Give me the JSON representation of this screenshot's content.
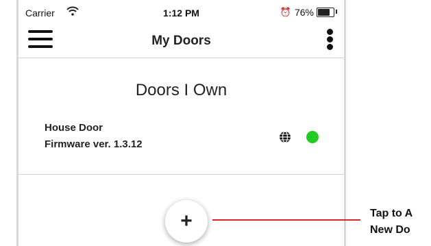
{
  "statusbar": {
    "carrier": "Carrier",
    "time": "1:12 PM",
    "battery_pct": "76%",
    "battery_level": 0.76
  },
  "navbar": {
    "title": "My Doors"
  },
  "section": {
    "title": "Doors I Own"
  },
  "door": {
    "name": "House Door",
    "firmware": "Firmware ver. 1.3.12",
    "status_color": "#22cc22"
  },
  "fab": {
    "label": "+"
  },
  "callout": {
    "line1": "Tap to A",
    "line2": "New Do",
    "color": "#d9252a"
  }
}
